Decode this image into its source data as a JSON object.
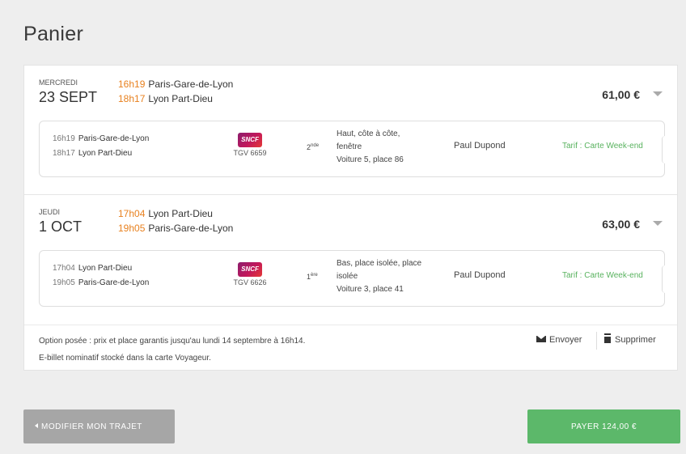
{
  "page": {
    "title": "Panier"
  },
  "journeys": [
    {
      "weekday": "MERCREDI",
      "date": "23 SEPT",
      "dep_time": "16h19",
      "dep_station": "Paris-Gare-de-Lyon",
      "arr_time": "18h17",
      "arr_station": "Lyon Part-Dieu",
      "price": "61,00 €",
      "segment": {
        "dep_time": "16h19",
        "dep_station": "Paris-Gare-de-Lyon",
        "arr_time": "18h17",
        "arr_station": "Lyon Part-Dieu",
        "operator_logo": "SNCF",
        "train": "TGV 6659",
        "class_num": "2",
        "class_sup": "nde",
        "seat_line1": "Haut, côte à côte,",
        "seat_line2": "fenêtre",
        "seat_line3": "Voiture 5, place 86",
        "passenger": "Paul Dupond",
        "tarif": "Tarif : Carte Week-end"
      }
    },
    {
      "weekday": "JEUDI",
      "date": "1 OCT",
      "dep_time": "17h04",
      "dep_station": "Lyon Part-Dieu",
      "arr_time": "19h05",
      "arr_station": "Paris-Gare-de-Lyon",
      "price": "63,00 €",
      "segment": {
        "dep_time": "17h04",
        "dep_station": "Lyon Part-Dieu",
        "arr_time": "19h05",
        "arr_station": "Paris-Gare-de-Lyon",
        "operator_logo": "SNCF",
        "train": "TGV 6626",
        "class_num": "1",
        "class_sup": "ère",
        "seat_line1": "Bas, place isolée, place",
        "seat_line2": "isolée",
        "seat_line3": "Voiture 3, place 41",
        "passenger": "Paul Dupond",
        "tarif": "Tarif : Carte Week-end"
      }
    }
  ],
  "footer": {
    "option_note": "Option posée : prix et place garantis jusqu'au lundi 14 septembre à 16h14.",
    "ticket_note": "E-billet nominatif stocké dans la carte Voyageur.",
    "send_label": "Envoyer",
    "delete_label": "Supprimer"
  },
  "buttons": {
    "modify_label": "MODIFIER MON TRAJET",
    "pay_label": "PAYER 124,00 €"
  },
  "colors": {
    "accent_time": "#e8811f",
    "tarif": "#58b25e",
    "pay_button": "#5cb86a",
    "modify_button": "#a6a6a6"
  },
  "icons": [
    "chevron-down-icon",
    "envelope-icon",
    "trash-icon",
    "sncf-logo",
    "back-triangle-icon"
  ]
}
